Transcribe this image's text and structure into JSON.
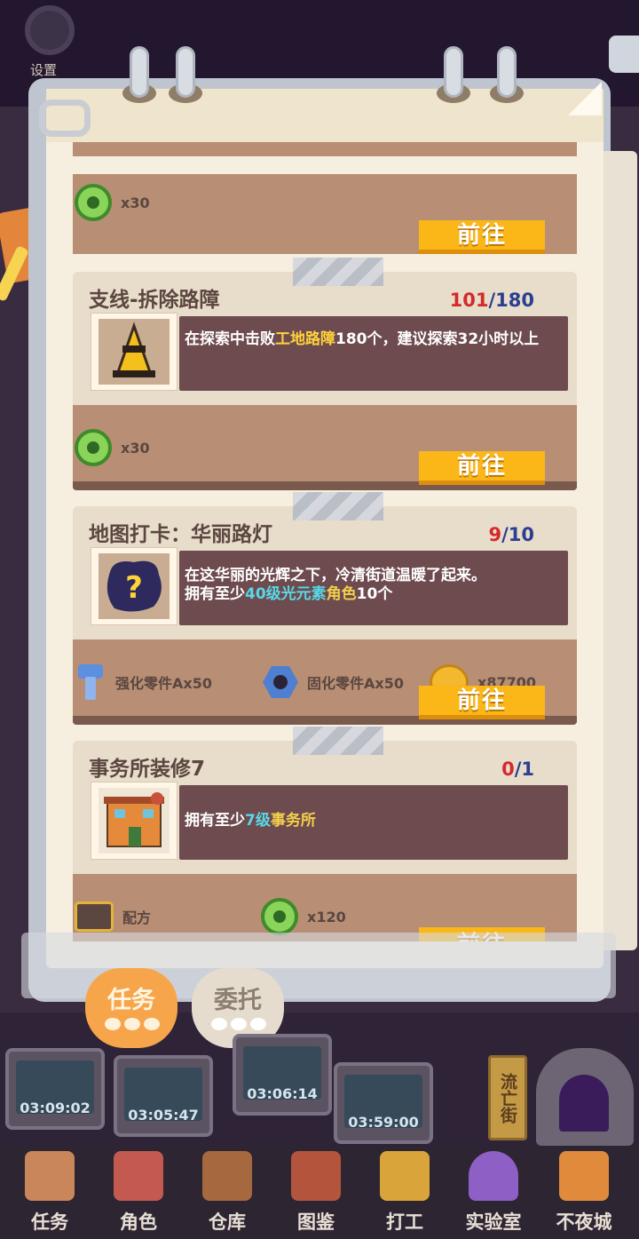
{
  "settings": {
    "label": "设置"
  },
  "top_card": {
    "reward_amount": "x30",
    "go_label": "前往"
  },
  "tasks": [
    {
      "title": "支线-拆除路障",
      "progress_current": "101",
      "progress_total": "180",
      "desc_pre": "在探索中击败",
      "desc_hl": "工地路障",
      "desc_post": "180个，建议探索32小时以上",
      "rewards": [
        {
          "icon": "green-gear-coin-icon",
          "text": "x30"
        }
      ],
      "go_label": "前往"
    },
    {
      "title": "地图打卡：华丽路灯",
      "progress_current": "9",
      "progress_total": "10",
      "desc_line1": "在这华丽的光辉之下，冷清街道温暖了起来。",
      "desc_pre": "拥有至少",
      "desc_hl": "40级光元素",
      "desc_hl2": "角色",
      "desc_post": "10个",
      "rewards": [
        {
          "icon": "reinforce-bolt-icon",
          "text": "强化零件Ax50"
        },
        {
          "icon": "hex-nut-icon",
          "text": "固化零件Ax50"
        },
        {
          "icon": "gold-planet-coin-icon",
          "text": "x87700"
        }
      ],
      "go_label": "前往"
    },
    {
      "title": "事务所装修7",
      "progress_current": "0",
      "progress_total": "1",
      "desc_pre": "拥有至少",
      "desc_hl": "7级",
      "desc_hl2": "事务所",
      "rewards": [
        {
          "icon": "toolbox-icon",
          "text": "配方"
        },
        {
          "icon": "green-gear-coin-icon",
          "text": "x120"
        }
      ],
      "go_label": "前往"
    }
  ],
  "tabs": {
    "task": "任务",
    "delegate": "委托"
  },
  "machines": [
    {
      "timer": "03:09:02"
    },
    {
      "timer": "03:05:47"
    },
    {
      "timer": "03:06:14"
    },
    {
      "timer": "03:59:00"
    }
  ],
  "street_sign": "流亡街",
  "nav": [
    {
      "label": "任务",
      "icon": "clipboard-icon",
      "color": "#c9865a"
    },
    {
      "label": "角色",
      "icon": "character-icon",
      "color": "#c45a4f"
    },
    {
      "label": "仓库",
      "icon": "warehouse-chest-icon",
      "color": "#a5683f"
    },
    {
      "label": "图鉴",
      "icon": "book-icon",
      "color": "#b2553c"
    },
    {
      "label": "打工",
      "icon": "work-frame-icon",
      "color": "#d9a43a"
    },
    {
      "label": "实验室",
      "icon": "lab-jar-icon",
      "color": "#8e5fc4"
    },
    {
      "label": "不夜城",
      "icon": "city-cat-icon",
      "color": "#e08a3c"
    }
  ]
}
